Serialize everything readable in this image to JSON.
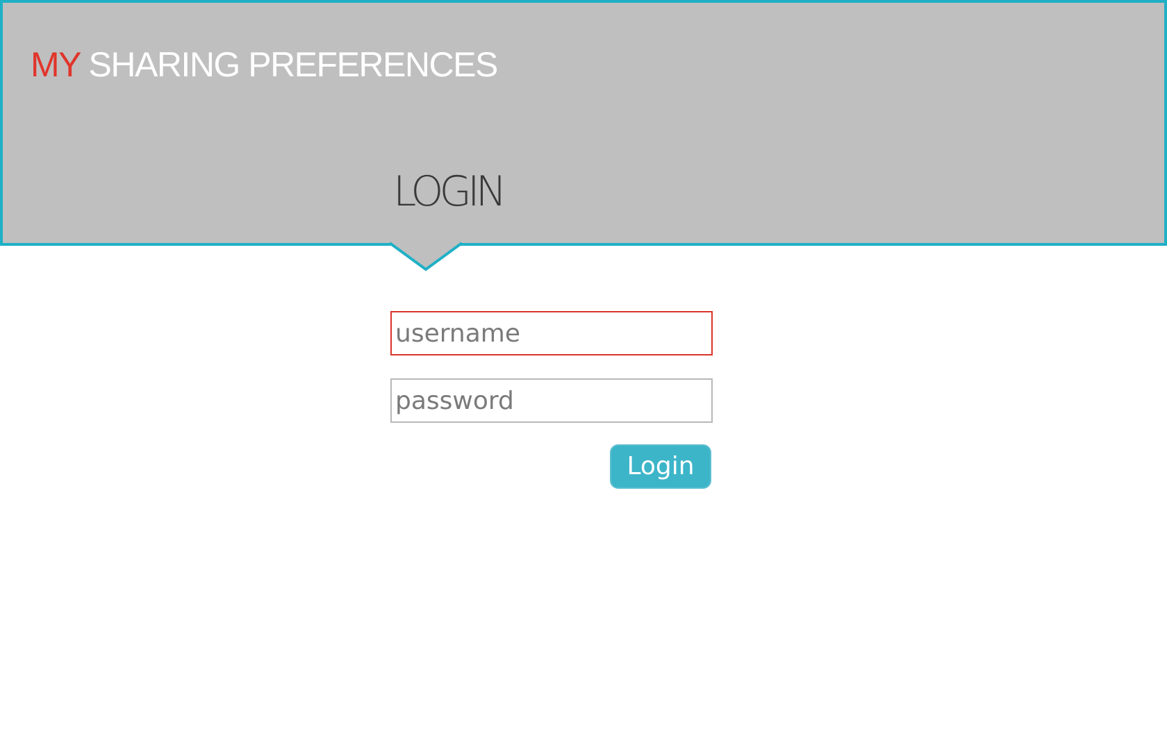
{
  "header": {
    "title_part1": "MY",
    "title_part2": "SHARING PREFERENCES",
    "section_title": "LOGIN"
  },
  "form": {
    "username_placeholder": "username",
    "password_placeholder": "password",
    "login_label": "Login"
  },
  "colors": {
    "accent": "#1fb0c6",
    "brand_red": "#e0352b",
    "header_bg": "#bfbfbf",
    "button_bg": "#3db5c9",
    "error_border": "#d9342b"
  }
}
